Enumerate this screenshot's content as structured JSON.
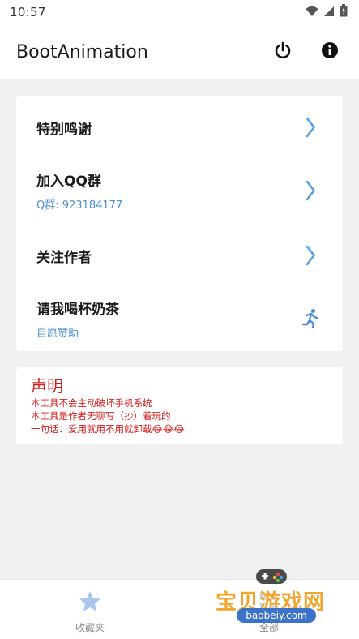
{
  "status_bar": {
    "time": "10:57"
  },
  "app_bar": {
    "title": "BootAnimation"
  },
  "menu": {
    "items": [
      {
        "title": "特别鸣谢",
        "subtitle": "",
        "icon": "chevron-right-icon"
      },
      {
        "title": "加入QQ群",
        "subtitle": "Q群: 923184177",
        "icon": "chevron-right-icon"
      },
      {
        "title": "关注作者",
        "subtitle": "",
        "icon": "chevron-right-icon"
      },
      {
        "title": "请我喝杯奶茶",
        "subtitle": "自愿赞助",
        "icon": "running-person-icon"
      }
    ]
  },
  "notice": {
    "title": "声明",
    "lines": [
      "本工具不会主动破坏手机系统",
      "本工具是作者无聊写（抄）着玩的",
      "一句话：爱用就用不用就卸载😂😂😂"
    ]
  },
  "bottom_nav": {
    "items": [
      {
        "label": "收藏夹",
        "icon": "star-icon"
      },
      {
        "label": "全部",
        "icon": "grid-icon"
      }
    ]
  },
  "watermark": {
    "text": "宝贝游戏网",
    "sub": "baobeiy.com"
  },
  "colors": {
    "accent": "#4a8fd4",
    "notice_red": "#d81b1b",
    "chevron": "#5b9fe0",
    "nav_star": "#a9c6ee"
  }
}
